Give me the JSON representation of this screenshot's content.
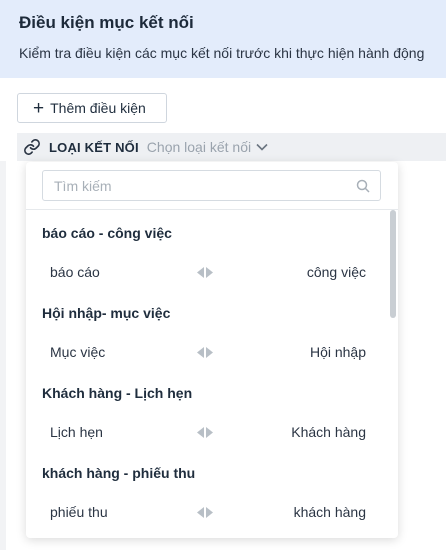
{
  "header": {
    "title": "Điều kiện mục kết nối",
    "subtitle": "Kiểm tra điều kiện các mục kết nối trước khi thực hiện hành động"
  },
  "add_condition": {
    "label": "Thêm điều kiện"
  },
  "connection": {
    "label": "LOẠI KẾT NỐI",
    "placeholder": "Chọn loại kết nối"
  },
  "dropdown": {
    "search_placeholder": "Tìm kiếm",
    "groups": [
      {
        "title": "báo cáo - công việc",
        "left": "báo cáo",
        "right": "công việc"
      },
      {
        "title": "Hội nhập- mục việc",
        "left": "Mục việc",
        "right": "Hội nhập"
      },
      {
        "title": "Khách hàng - Lịch hẹn",
        "left": "Lịch hẹn",
        "right": "Khách hàng"
      },
      {
        "title": "khách hàng - phiếu thu",
        "left": "phiếu thu",
        "right": "khách hàng"
      }
    ]
  },
  "colors": {
    "header_bg": "#e3ecfb",
    "bar_bg": "#eef0f3",
    "muted_text": "#9aa3ad"
  },
  "icons": [
    "plus-icon",
    "link-icon",
    "chevron-down-icon",
    "search-icon",
    "arrow-left-icon",
    "arrow-right-icon"
  ]
}
